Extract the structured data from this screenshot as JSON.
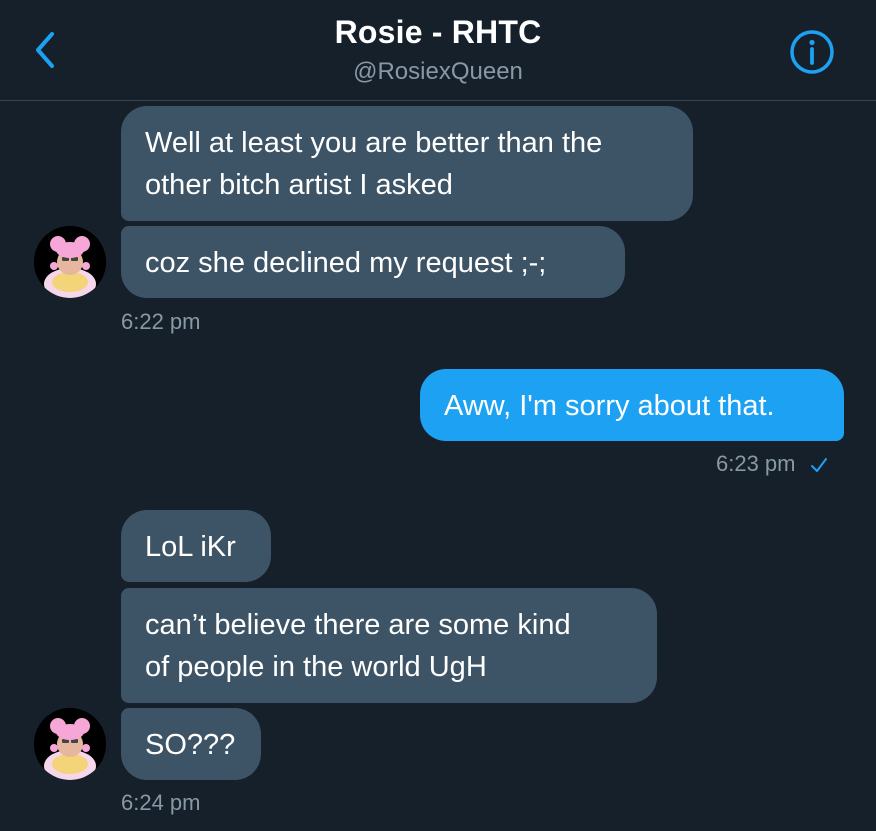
{
  "header": {
    "title": "Rosie - RHTC",
    "handle": "@RosiexQueen",
    "back_icon": "chevron-left-icon",
    "info_icon": "info-icon"
  },
  "colors": {
    "background": "#15202b",
    "incoming_bubble": "#3d5466",
    "outgoing_bubble": "#1da1f2",
    "accent": "#1da1f2",
    "muted_text": "#8899a6"
  },
  "messages": [
    {
      "from": "Rosie",
      "text": "Well at least you are better than the\nother bitch artist I asked"
    },
    {
      "from": "Rosie",
      "text": "coz she declined my request ;-;"
    },
    {
      "from": "me",
      "text": "Aww, I'm sorry about that."
    },
    {
      "from": "Rosie",
      "text": "LoL iKr"
    },
    {
      "from": "Rosie",
      "text": "can’t believe there are some kind\nof people in the world UgH"
    },
    {
      "from": "Rosie",
      "text": "SO???"
    }
  ],
  "timestamps": {
    "group1": "6:22 pm",
    "group2": "6:23 pm",
    "group3": "6:24 pm"
  },
  "read_receipt_icon": "checkmark-icon"
}
